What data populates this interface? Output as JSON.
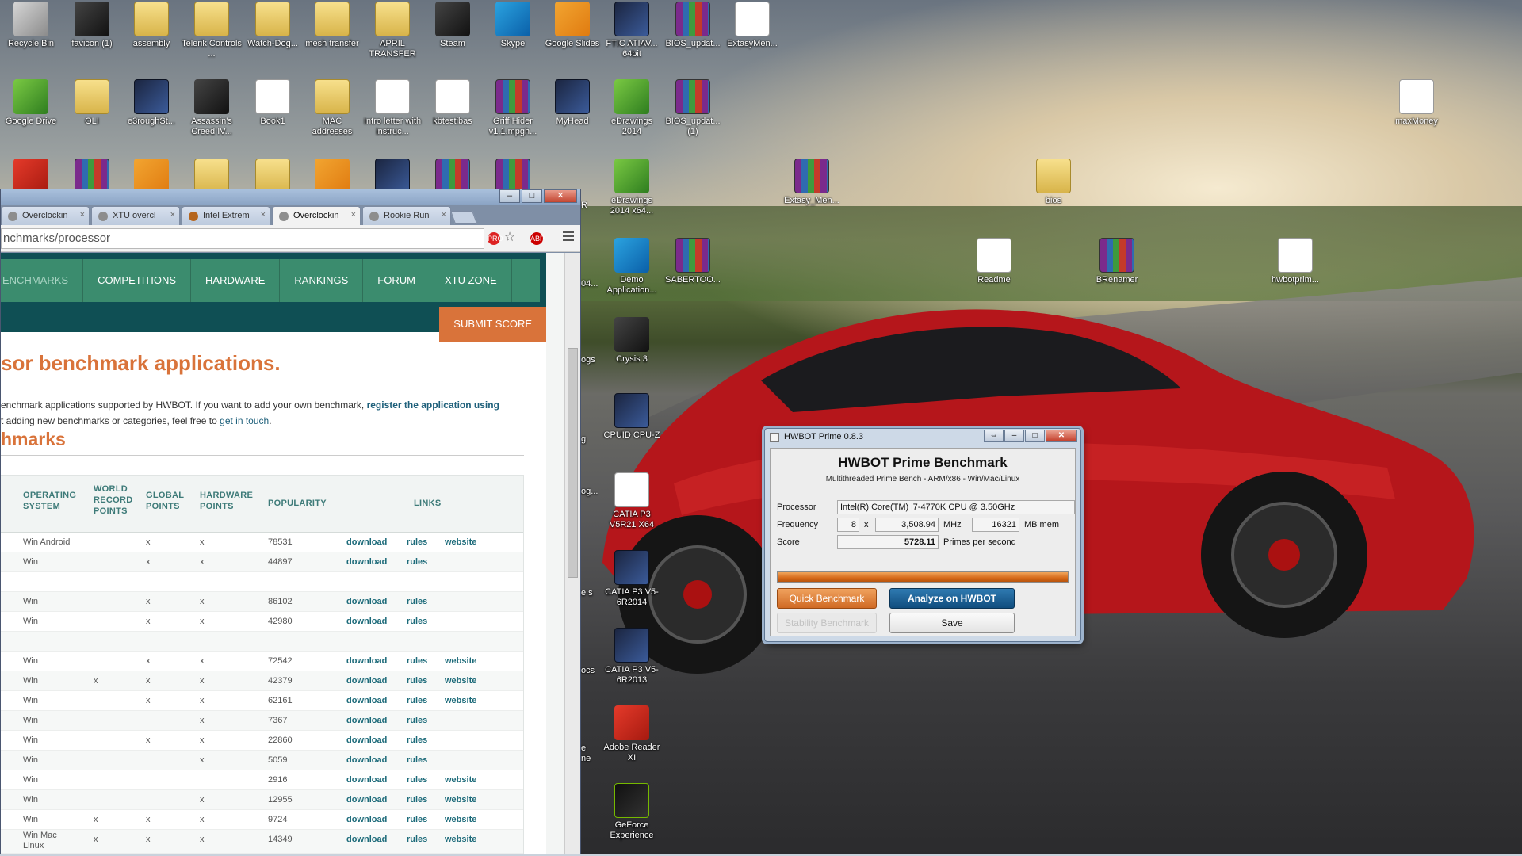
{
  "desktop": {
    "icons": [
      {
        "label": "Recycle Bin",
        "style": "g-gray"
      },
      {
        "label": "favicon (1)",
        "style": "g-dark"
      },
      {
        "label": "assembly",
        "style": "g-folder"
      },
      {
        "label": "Telerik Controls ...",
        "style": "g-folder"
      },
      {
        "label": "Watch-Dog...",
        "style": "g-folder"
      },
      {
        "label": "mesh transfer",
        "style": "g-folder"
      },
      {
        "label": "APRIL TRANSFER",
        "style": "g-folder"
      },
      {
        "label": "Steam",
        "style": "g-dark"
      },
      {
        "label": "Skype",
        "style": "g-blue"
      },
      {
        "label": "Google Slides",
        "style": "g-orange"
      },
      {
        "label": "FTIC ATIAV... 64bit",
        "style": "g-app"
      },
      {
        "label": "BIOS_updat...",
        "style": "g-rar"
      },
      {
        "label": "ExtasyMen...",
        "style": "g-doc"
      },
      {
        "label": "Google Drive",
        "style": "g-green"
      },
      {
        "label": "OLI",
        "style": "g-folder"
      },
      {
        "label": "e3roughSt...",
        "style": "g-app"
      },
      {
        "label": "Assassin's Creed IV...",
        "style": "g-dark"
      },
      {
        "label": "Book1",
        "style": "g-doc"
      },
      {
        "label": "MAC addresses",
        "style": "g-folder"
      },
      {
        "label": "Intro letter with instruc...",
        "style": "g-doc"
      },
      {
        "label": "kbtestibas",
        "style": "g-doc"
      },
      {
        "label": "Griff Hider v1.1.mpgh...",
        "style": "g-rar"
      },
      {
        "label": "MyHead",
        "style": "g-app"
      },
      {
        "label": "eDrawings 2014",
        "style": "g-green"
      },
      {
        "label": "BIOS_updat... (1)",
        "style": "g-rar"
      },
      {
        "label": "maxMoney",
        "style": "g-doc"
      },
      {
        "label": "",
        "style": "g-red"
      },
      {
        "label": "",
        "style": "g-rar"
      },
      {
        "label": "",
        "style": "g-orange"
      },
      {
        "label": "",
        "style": "g-folder"
      },
      {
        "label": "",
        "style": "g-folder"
      },
      {
        "label": "",
        "style": "g-orange"
      },
      {
        "label": "",
        "style": "g-app"
      },
      {
        "label": "",
        "style": "g-rar"
      },
      {
        "label": "",
        "style": "g-rar"
      },
      {
        "label": "eDrawings 2014 x64...",
        "style": "g-green"
      },
      {
        "label": "Extasy_Men...",
        "style": "g-rar"
      },
      {
        "label": "bios",
        "style": "g-folder"
      },
      {
        "label": "Demo Application...",
        "style": "g-blue"
      },
      {
        "label": "SABERTOO...",
        "style": "g-rar"
      },
      {
        "label": "Readme",
        "style": "g-doc"
      },
      {
        "label": "BRenamer",
        "style": "g-rar"
      },
      {
        "label": "hwbotprim...",
        "style": "g-doc"
      },
      {
        "label": "Crysis 3",
        "style": "g-dark"
      },
      {
        "label": "CPUID CPU-Z",
        "style": "g-app"
      },
      {
        "label": "CATIA P3 V5R21 X64",
        "style": "g-doc"
      },
      {
        "label": "CATIA P3 V5-6R2014",
        "style": "g-app"
      },
      {
        "label": "CATIA P3 V5-6R2013",
        "style": "g-app"
      },
      {
        "label": "Adobe Reader XI",
        "style": "g-red"
      },
      {
        "label": "GeForce Experience",
        "style": "g-nvidia"
      }
    ],
    "partial_labels": [
      "R",
      "04...",
      "ogs",
      "g",
      "og...",
      "e s",
      "ocs",
      "e ne"
    ]
  },
  "browser": {
    "tabs": [
      {
        "label": "Overclockin"
      },
      {
        "label": "XTU overcl"
      },
      {
        "label": "Intel Extrem"
      },
      {
        "label": "Overclockin",
        "active": true
      },
      {
        "label": "Rookie Run"
      }
    ],
    "tab_close": "×",
    "window_buttons": {
      "minimize": "–",
      "maximize": "□",
      "close": "✕"
    },
    "url": "nchmarks/processor",
    "ext_pro": "PRO",
    "ext_abp": "ABP",
    "star": "☆",
    "nav": [
      "ENCHMARKS",
      "COMPETITIONS",
      "HARDWARE",
      "RANKINGS",
      "FORUM",
      "XTU ZONE"
    ],
    "submit": "SUBMIT SCORE",
    "headline": "sor benchmark applications.",
    "intro_line1_a": "enchmark applications supported by HWBOT. If you want to add your own benchmark, ",
    "intro_line1_link": "register the application using",
    "intro_line2_a": "t adding new benchmarks or categories, feel free to ",
    "intro_line2_link": "get in touch",
    "intro_line2_b": ".",
    "subheading": "hmarks",
    "columns": {
      "os": [
        "OPERATING",
        "SYSTEM"
      ],
      "wr": [
        "WORLD",
        "RECORD",
        "POINTS"
      ],
      "global": [
        "GLOBAL",
        "POINTS"
      ],
      "hardware": [
        "HARDWARE",
        "POINTS"
      ],
      "popularity": "POPULARITY",
      "links": "LINKS"
    },
    "rows": [
      {
        "os": "Win Android",
        "wr": "",
        "global": "x",
        "hw": "x",
        "pop": "78531",
        "dl": "download",
        "rules": "rules",
        "site": "website"
      },
      {
        "os": "Win",
        "wr": "",
        "global": "x",
        "hw": "x",
        "pop": "44897",
        "dl": "download",
        "rules": "rules",
        "site": ""
      },
      {
        "os": "",
        "wr": "",
        "global": "",
        "hw": "",
        "pop": "",
        "dl": "",
        "rules": "",
        "site": ""
      },
      {
        "os": "Win",
        "wr": "",
        "global": "x",
        "hw": "x",
        "pop": "86102",
        "dl": "download",
        "rules": "rules",
        "site": ""
      },
      {
        "os": "Win",
        "wr": "",
        "global": "x",
        "hw": "x",
        "pop": "42980",
        "dl": "download",
        "rules": "rules",
        "site": ""
      },
      {
        "os": "",
        "wr": "",
        "global": "",
        "hw": "",
        "pop": "",
        "dl": "",
        "rules": "",
        "site": ""
      },
      {
        "os": "Win",
        "wr": "",
        "global": "x",
        "hw": "x",
        "pop": "72542",
        "dl": "download",
        "rules": "rules",
        "site": "website"
      },
      {
        "os": "Win",
        "wr": "x",
        "global": "x",
        "hw": "x",
        "pop": "42379",
        "dl": "download",
        "rules": "rules",
        "site": "website"
      },
      {
        "os": "Win",
        "wr": "",
        "global": "x",
        "hw": "x",
        "pop": "62161",
        "dl": "download",
        "rules": "rules",
        "site": "website"
      },
      {
        "os": "Win",
        "wr": "",
        "global": "",
        "hw": "x",
        "pop": "7367",
        "dl": "download",
        "rules": "rules",
        "site": ""
      },
      {
        "os": "Win",
        "wr": "",
        "global": "x",
        "hw": "x",
        "pop": "22860",
        "dl": "download",
        "rules": "rules",
        "site": ""
      },
      {
        "os": "Win",
        "wr": "",
        "global": "",
        "hw": "x",
        "pop": "5059",
        "dl": "download",
        "rules": "rules",
        "site": ""
      },
      {
        "os": "Win",
        "wr": "",
        "global": "",
        "hw": "",
        "pop": "2916",
        "dl": "download",
        "rules": "rules",
        "site": "website"
      },
      {
        "os": "Win",
        "wr": "",
        "global": "",
        "hw": "x",
        "pop": "12955",
        "dl": "download",
        "rules": "rules",
        "site": "website"
      },
      {
        "os": "Win",
        "wr": "x",
        "global": "x",
        "hw": "x",
        "pop": "9724",
        "dl": "download",
        "rules": "rules",
        "site": "website"
      },
      {
        "os": "Win Mac Linux",
        "wr": "x",
        "global": "x",
        "hw": "x",
        "pop": "14349",
        "dl": "download",
        "rules": "rules",
        "site": "website"
      }
    ]
  },
  "hwbot": {
    "window_title": "HWBOT Prime 0.8.3",
    "buttons": {
      "resize": "⇔",
      "minimize": "–",
      "maximize": "□",
      "close": "✕"
    },
    "heading": "HWBOT Prime Benchmark",
    "subheading": "Multithreaded Prime Bench - ARM/x86 - Win/Mac/Linux",
    "processor_label": "Processor",
    "processor_value": "Intel(R) Core(TM) i7-4770K CPU @ 3.50GHz",
    "frequency_label": "Frequency",
    "threads": "8",
    "times": "x",
    "frequency_value": "3,508.94",
    "mhz": "MHz",
    "mem_value": "16321",
    "mem_unit": "MB mem",
    "score_label": "Score",
    "score_value": "5728.11",
    "score_unit": "Primes per second",
    "progress": 1.0,
    "quick_button": "Quick Benchmark",
    "analyze_button": "Analyze on HWBOT",
    "stability_button": "Stability Benchmark",
    "save_button": "Save"
  }
}
